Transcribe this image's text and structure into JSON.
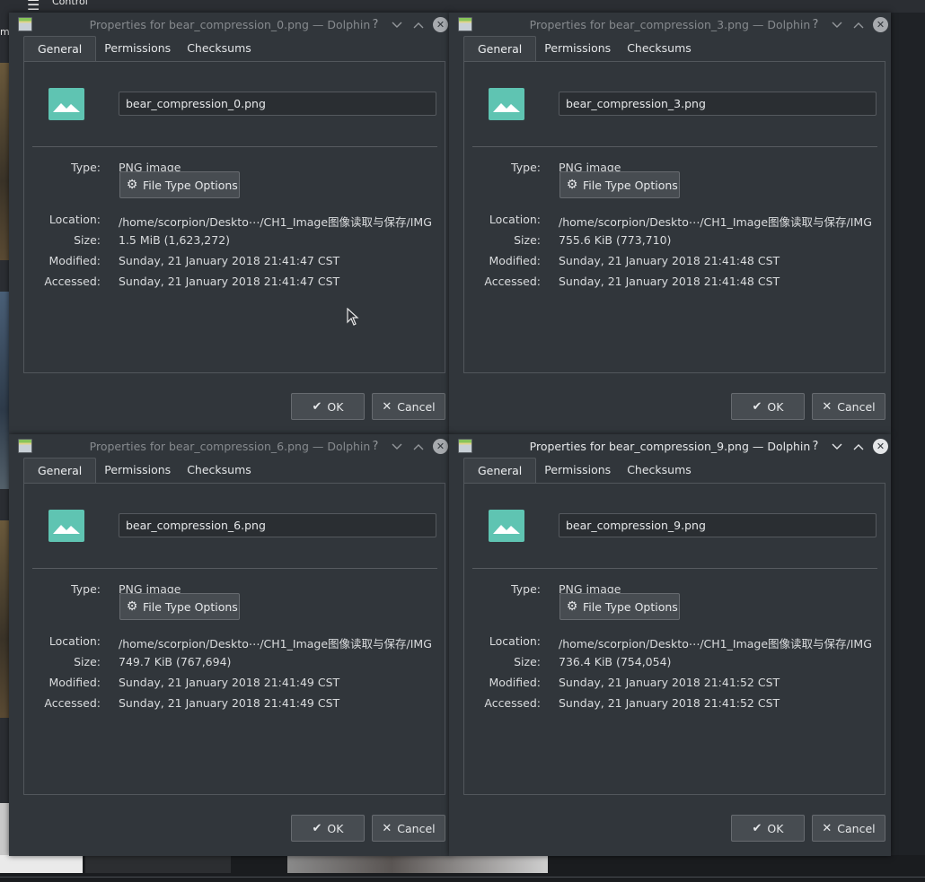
{
  "background": {
    "menu_label": "Control",
    "partial_label": "ma"
  },
  "labels": {
    "type": "Type:",
    "location": "Location:",
    "size": "Size:",
    "modified": "Modified:",
    "accessed": "Accessed:",
    "file_type_options": "File Type Options",
    "ok": "OK",
    "cancel": "Cancel"
  },
  "tabs": [
    "General",
    "Permissions",
    "Checksums"
  ],
  "dialogs": [
    {
      "title": "Properties for bear_compression_0.png — Dolphin",
      "filename": "bear_compression_0.png",
      "type": "PNG image",
      "location": "/home/scorpion/Deskto⋯/CH1_Image图像读取与保存/IMG",
      "size": "1.5 MiB (1,623,272)",
      "modified": "Sunday, 21 January 2018 21:41:47 CST",
      "accessed": "Sunday, 21 January 2018 21:41:47 CST",
      "active": false
    },
    {
      "title": "Properties for bear_compression_3.png — Dolphin",
      "filename": "bear_compression_3.png",
      "type": "PNG image",
      "location": "/home/scorpion/Deskto⋯/CH1_Image图像读取与保存/IMG",
      "size": "755.6 KiB (773,710)",
      "modified": "Sunday, 21 January 2018 21:41:48 CST",
      "accessed": "Sunday, 21 January 2018 21:41:48 CST",
      "active": false
    },
    {
      "title": "Properties for bear_compression_6.png — Dolphin",
      "filename": "bear_compression_6.png",
      "type": "PNG image",
      "location": "/home/scorpion/Deskto⋯/CH1_Image图像读取与保存/IMG",
      "size": "749.7 KiB (767,694)",
      "modified": "Sunday, 21 January 2018 21:41:49 CST",
      "accessed": "Sunday, 21 January 2018 21:41:49 CST",
      "active": false
    },
    {
      "title": "Properties for bear_compression_9.png — Dolphin",
      "filename": "bear_compression_9.png",
      "type": "PNG image",
      "location": "/home/scorpion/Deskto⋯/CH1_Image图像读取与保存/IMG",
      "size": "736.4 KiB (754,054)",
      "modified": "Sunday, 21 January 2018 21:41:52 CST",
      "accessed": "Sunday, 21 January 2018 21:41:52 CST",
      "active": true
    }
  ],
  "icons": {
    "app": "dolphin-app-icon",
    "help": "question-mark-icon",
    "minimize": "chevron-down-icon",
    "maximize": "chevron-up-icon",
    "close": "close-icon",
    "file": "image-file-icon",
    "settings": "gear-icon",
    "ok": "checkmark-icon",
    "cancel": "x-icon"
  },
  "colors": {
    "window_bg": "#31363b",
    "file_icon": "#5fc4b2",
    "text": "#dadcde"
  }
}
